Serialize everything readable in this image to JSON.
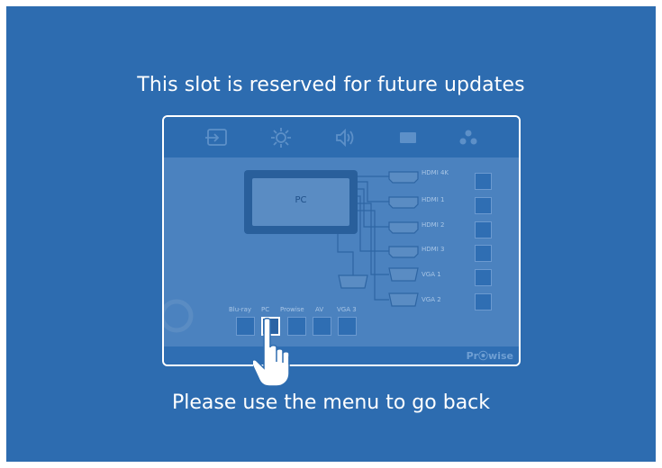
{
  "message": {
    "title": "This slot is reserved for future updates",
    "subtitle": "Please use the menu to go back"
  },
  "panel": {
    "tabs": [
      {
        "icon": "input-source-icon"
      },
      {
        "icon": "brightness-icon"
      },
      {
        "icon": "speaker-icon"
      },
      {
        "icon": "display-icon"
      },
      {
        "icon": "apps-icon"
      }
    ],
    "monitor_label": "PC",
    "ports": [
      "HDMI 4K",
      "HDMI 1",
      "HDMI 2",
      "HDMI 3",
      "VGA 1",
      "VGA 2"
    ],
    "bottom_sources": [
      "Blu-ray",
      "PC",
      "Prowise",
      "AV",
      "VGA 3"
    ],
    "selected_source": "PC",
    "brand": "Pr⦿wise"
  },
  "colors": {
    "background": "#2d6cb0",
    "panel_fill": "#4b82bf",
    "text": "#ffffff"
  }
}
